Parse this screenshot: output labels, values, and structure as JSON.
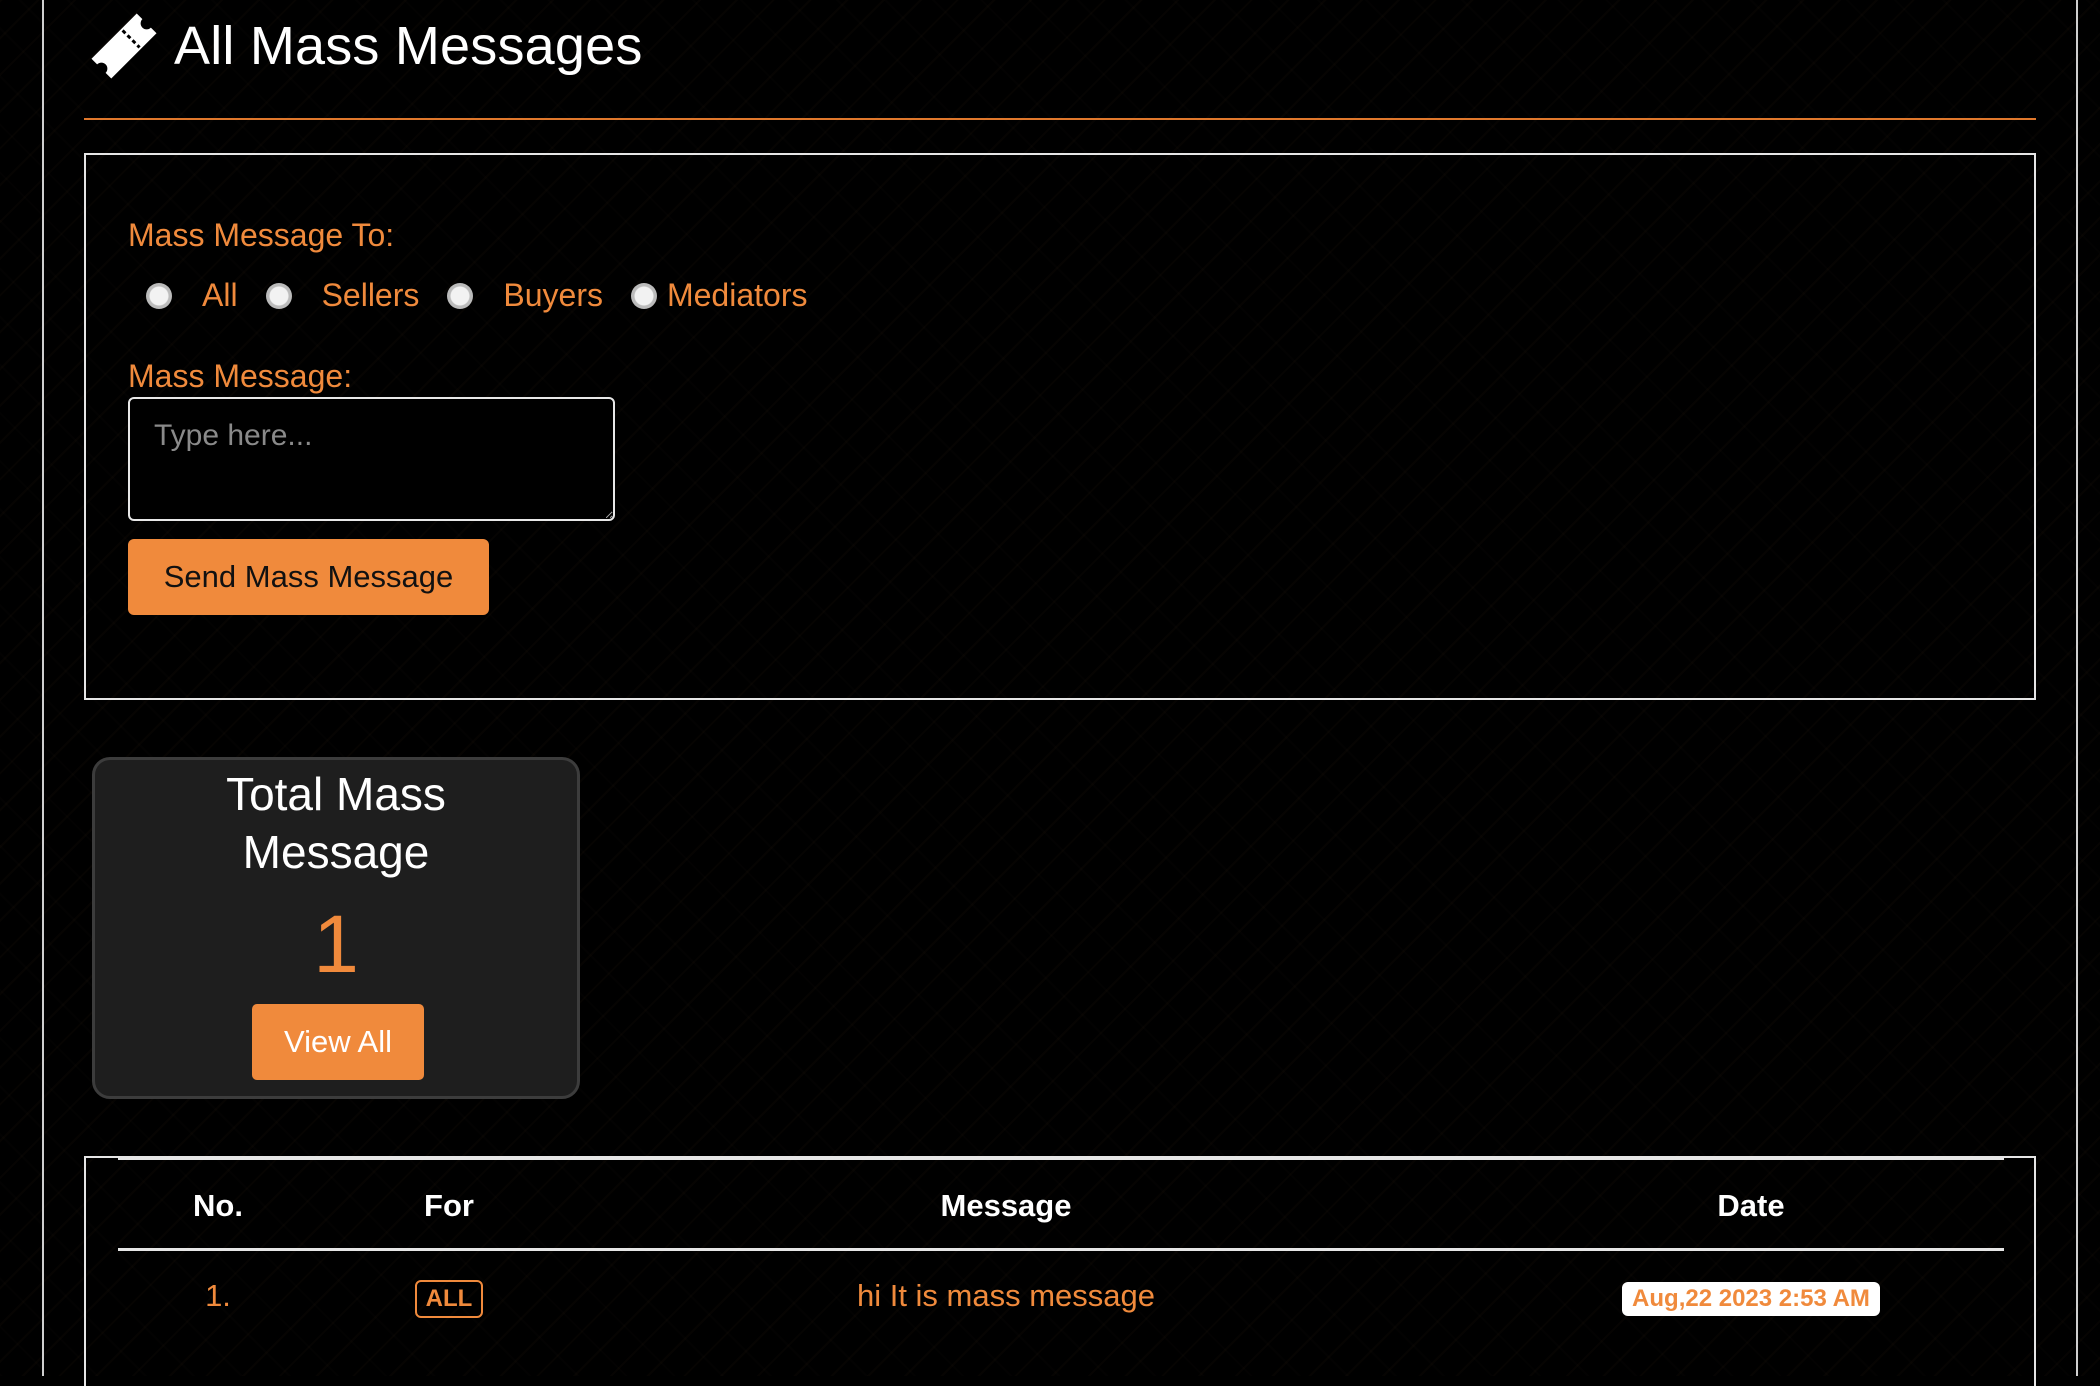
{
  "header": {
    "title": "All Mass Messages",
    "icon": "ticket-icon"
  },
  "form": {
    "to_label": "Mass Message To:",
    "options": [
      "All",
      "Sellers",
      "Buyers",
      "Mediators"
    ],
    "message_label": "Mass Message:",
    "message_placeholder": "Type here...",
    "send_label": "Send Mass Message"
  },
  "stats": {
    "title": "Total Mass Message",
    "value": "1",
    "view_all_label": "View All"
  },
  "table": {
    "headers": {
      "no": "No.",
      "for": "For",
      "message": "Message",
      "date": "Date"
    },
    "rows": [
      {
        "no": "1.",
        "for": "ALL",
        "message": "hi It is mass message",
        "date": "Aug,22 2023 2:53 AM"
      }
    ]
  },
  "colors": {
    "accent": "#f08a3c",
    "background": "#000000",
    "card": "#1e1e1e"
  }
}
